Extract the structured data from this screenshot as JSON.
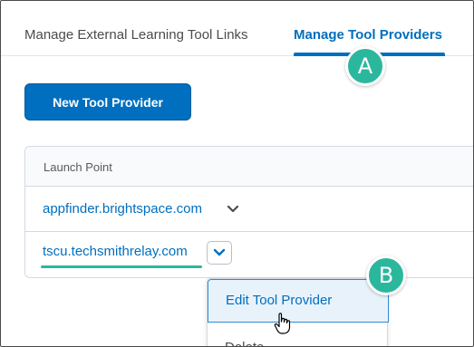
{
  "tabs": {
    "external_links": "Manage External Learning Tool Links",
    "tool_providers": "Manage Tool Providers"
  },
  "callouts": {
    "a": "A",
    "b": "B"
  },
  "toolbar": {
    "new_tool_provider": "New Tool Provider"
  },
  "table": {
    "header": "Launch Point",
    "rows": [
      {
        "launch_point": "appfinder.brightspace.com"
      },
      {
        "launch_point": "tscu.techsmithrelay.com"
      }
    ]
  },
  "menu": {
    "edit": "Edit Tool Provider",
    "delete": "Delete"
  },
  "colors": {
    "brand_blue": "#006fbf",
    "callout_teal": "#2bb79d"
  },
  "icons": [
    "chevron-down-icon",
    "hand-pointer-icon"
  ]
}
